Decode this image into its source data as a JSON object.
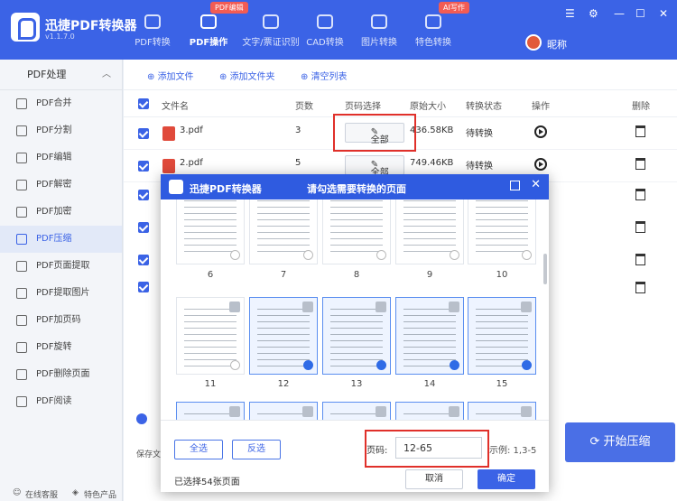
{
  "app": {
    "name": "迅捷PDF转换器",
    "version": "v1.1.7.0"
  },
  "nav": {
    "tabs": [
      {
        "label": "PDF转换",
        "badge": ""
      },
      {
        "label": "PDF操作",
        "badge": "PDF编辑"
      },
      {
        "label": "文字/票证识别",
        "badge": ""
      },
      {
        "label": "CAD转换",
        "badge": ""
      },
      {
        "label": "图片转换",
        "badge": ""
      },
      {
        "label": "特色转换",
        "badge": "AI写作"
      }
    ],
    "user": "昵称"
  },
  "sidebar": {
    "header": "PDF处理",
    "items": [
      {
        "label": "PDF合并",
        "icon": "merge-icon"
      },
      {
        "label": "PDF分割",
        "icon": "split-icon"
      },
      {
        "label": "PDF编辑",
        "icon": "edit-icon"
      },
      {
        "label": "PDF解密",
        "icon": "unlock-icon"
      },
      {
        "label": "PDF加密",
        "icon": "shield-icon"
      },
      {
        "label": "PDF压缩",
        "icon": "compress-icon"
      },
      {
        "label": "PDF页面提取",
        "icon": "extract-page-icon"
      },
      {
        "label": "PDF提取图片",
        "icon": "image-icon"
      },
      {
        "label": "PDF加页码",
        "icon": "page-number-icon"
      },
      {
        "label": "PDF旋转",
        "icon": "rotate-icon"
      },
      {
        "label": "PDF删除页面",
        "icon": "delete-page-icon"
      },
      {
        "label": "PDF阅读",
        "icon": "read-icon"
      }
    ],
    "footer": {
      "service": "在线客服",
      "features": "特色产品"
    }
  },
  "toolbar": {
    "add_file": "添加文件",
    "add_folder": "添加文件夹",
    "clear": "清空列表"
  },
  "table": {
    "headers": [
      "文件名",
      "页数",
      "页码选择",
      "原始大小",
      "转换状态",
      "操作",
      "删除"
    ],
    "rows": [
      {
        "name": "3.pdf",
        "pages": "3",
        "range": "全部",
        "size": "436.58KB",
        "status": "待转换"
      },
      {
        "name": "2.pdf",
        "pages": "5",
        "range": "全部",
        "size": "749.46KB",
        "status": "待转换"
      }
    ]
  },
  "main": {
    "save_label": "保存文",
    "start_button": "开始压缩"
  },
  "modal": {
    "title": "迅捷PDF转换器",
    "subtitle": "请勾选需要转换的页面",
    "page_numbers": [
      "6",
      "7",
      "8",
      "9",
      "10",
      "11",
      "12",
      "13",
      "14",
      "15"
    ],
    "select_all": "全选",
    "invert": "反选",
    "page_label": "页码:",
    "page_value": "12-65",
    "example": "示例: 1,3-5",
    "selected_count": "已选择54张页面",
    "cancel": "取消",
    "confirm": "确定"
  },
  "colors": {
    "accent": "#3b63e6",
    "highlight": "#e0302a"
  }
}
